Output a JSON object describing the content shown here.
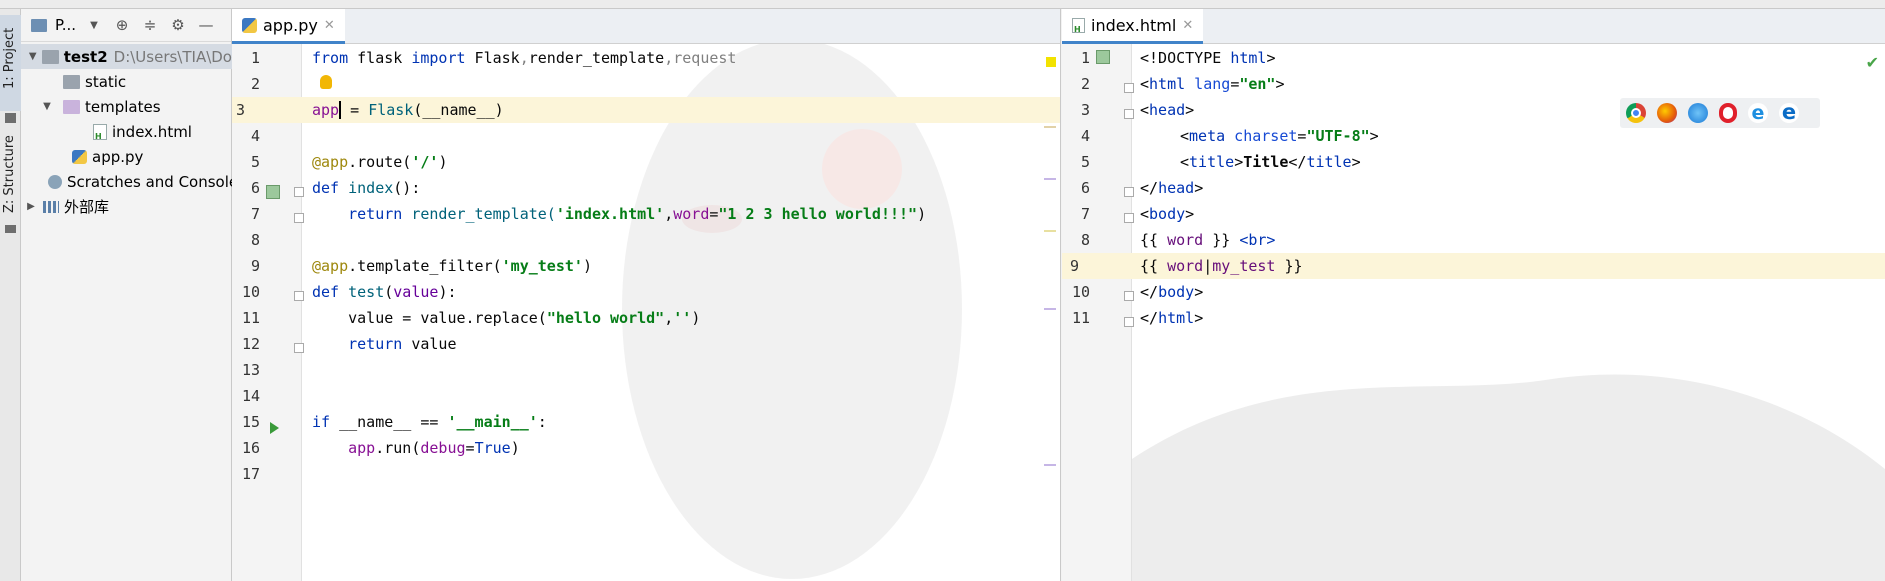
{
  "sidebar_stripe": {
    "project_tab": "1: Project",
    "structure_tab": "Z: Structure"
  },
  "project_panel": {
    "header_label": "P...",
    "tree": [
      {
        "label": "test2",
        "path": "D:\\Users\\TIA\\Do",
        "type": "folder",
        "expanded": true
      },
      {
        "label": "static",
        "type": "folder"
      },
      {
        "label": "templates",
        "type": "folder-purple",
        "expanded": true
      },
      {
        "label": "index.html",
        "type": "html"
      },
      {
        "label": "app.py",
        "type": "python"
      },
      {
        "label": "Scratches and Consoles",
        "type": "scratch"
      },
      {
        "label": "外部库",
        "type": "library"
      }
    ]
  },
  "left_editor": {
    "tab_label": "app.py",
    "line_numbers": [
      "1",
      "2",
      "3",
      "4",
      "5",
      "6",
      "7",
      "8",
      "9",
      "10",
      "11",
      "12",
      "13",
      "14",
      "15",
      "16",
      "17"
    ],
    "highlighted_line": 3
  },
  "right_editor": {
    "tab_label": "index.html",
    "line_numbers": [
      "1",
      "2",
      "3",
      "4",
      "5",
      "6",
      "7",
      "8",
      "9",
      "10",
      "11"
    ],
    "highlighted_line": 9
  },
  "code": {
    "l1": {
      "from": "from",
      "rest1": " flask ",
      "import": "import",
      "rest2": " Flask",
      "comma1": ",",
      "rt": "render_template",
      "comma2": ",",
      "req": "request"
    },
    "l3": {
      "app": "app",
      "eq": " = ",
      "flask": "Flask",
      "args": "(__name__)"
    },
    "l5": {
      "deco": "@app",
      "rest": ".route(",
      "str": "'/'",
      "close": ")"
    },
    "l6": {
      "def": "def",
      "name": " index",
      "rest": "():"
    },
    "l7": {
      "ret": "return",
      "fn": " render_template(",
      "str1": "'index.html'",
      "comma": ",",
      "kw": "word",
      "eq": "=",
      "str2": "\"1 2 3 hello world!!!\"",
      "close": ")"
    },
    "l9": {
      "deco": "@app",
      "rest": ".template_filter(",
      "str": "'my_test'",
      "close": ")"
    },
    "l10": {
      "def": "def",
      "name": " test",
      "open": "(",
      "param": "value",
      "close": "):"
    },
    "l11": {
      "var": "value",
      "eq": " = ",
      "obj": "value",
      "meth": ".replace(",
      "str1": "\"hello world\"",
      "comma": ",",
      "str2": "''",
      "close": ")"
    },
    "l12": {
      "ret": "return",
      "var": " value"
    },
    "l15": {
      "if": "if",
      "mid": " __name__ == ",
      "str": "'__main__'",
      "colon": ":"
    },
    "l16": {
      "app": "app",
      "run": ".run(",
      "kw": "debug",
      "eq": "=",
      "true": "True",
      "close": ")"
    }
  },
  "html_code": {
    "h1": {
      "open": "<!DOCTYPE ",
      "html": "html",
      "close": ">"
    },
    "h2": {
      "lt": "<",
      "tag": "html",
      "attr": " lang",
      "eq": "=",
      "val": "\"en\"",
      "gt": ">"
    },
    "h3": {
      "lt": "<",
      "tag": "head",
      "gt": ">"
    },
    "h4": {
      "lt": "<",
      "tag": "meta",
      "attr": " charset",
      "eq": "=",
      "val": "\"UTF-8\"",
      "gt": ">"
    },
    "h5": {
      "lt": "<",
      "tag": "title",
      "gt": ">",
      "text": "Title",
      "lt2": "</",
      "tag2": "title",
      "gt2": ">"
    },
    "h6": {
      "lt": "</",
      "tag": "head",
      "gt": ">"
    },
    "h7": {
      "lt": "<",
      "tag": "body",
      "gt": ">"
    },
    "h8": {
      "open": "{{ ",
      "var": "word",
      "close": " }} ",
      "br": "<br>"
    },
    "h9": {
      "open": "{{ ",
      "var": "word",
      "pipe": "|",
      "filter": "my_test",
      "close": " }}"
    },
    "h10": {
      "lt": "</",
      "tag": "body",
      "gt": ">"
    },
    "h11": {
      "lt": "</",
      "tag": "html",
      "gt": ">"
    }
  },
  "browser_icons": [
    "chrome-icon",
    "firefox-icon",
    "safari-icon",
    "opera-icon",
    "internet-explorer-icon",
    "edge-icon"
  ],
  "colors": {
    "keyword": "#0033b3",
    "string": "#067d17",
    "decorator": "#9e880d",
    "highlight_line": "#fcf5d9",
    "tab_underline": "#4083c9"
  }
}
